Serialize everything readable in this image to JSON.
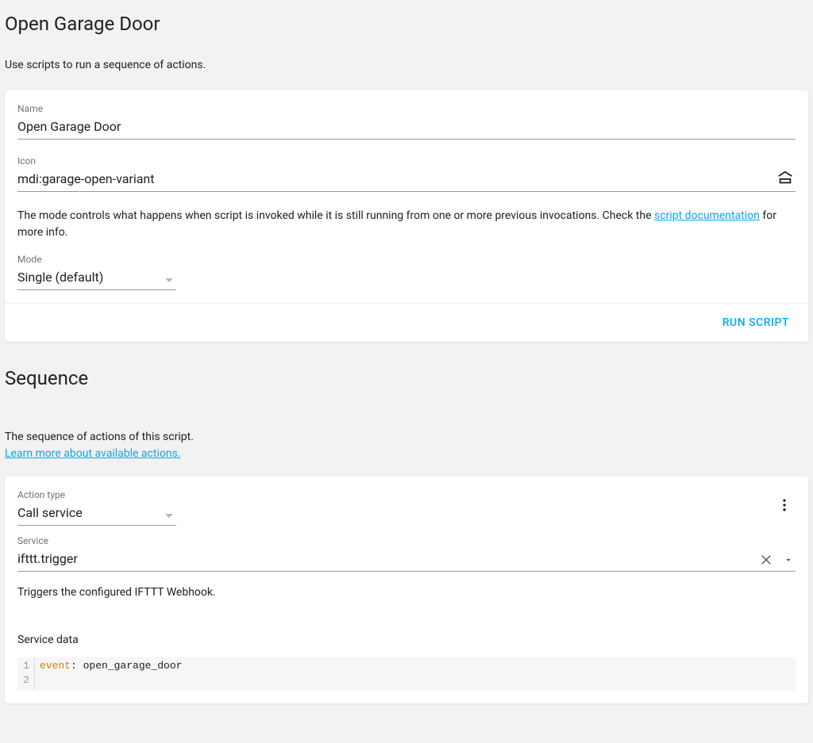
{
  "page": {
    "title": "Open Garage Door",
    "subtitle": "Use scripts to run a sequence of actions."
  },
  "form": {
    "name_label": "Name",
    "name_value": "Open Garage Door",
    "icon_label": "Icon",
    "icon_value": "mdi:garage-open-variant",
    "mode_helper_pre": "The mode controls what happens when script is invoked while it is still running from one or more previous invocations. Check the ",
    "mode_helper_link": "script documentation",
    "mode_helper_post": " for more info.",
    "mode_label": "Mode",
    "mode_value": "Single (default)",
    "run_button": "RUN SCRIPT"
  },
  "sequence": {
    "title": "Sequence",
    "subtitle": "The sequence of actions of this script.",
    "learn_link": "Learn more about available actions."
  },
  "action": {
    "action_type_label": "Action type",
    "action_type_value": "Call service",
    "service_label": "Service",
    "service_value": "ifttt.trigger",
    "service_description": "Triggers the configured IFTTT Webhook.",
    "service_data_label": "Service data",
    "code_line1_key": "event",
    "code_line1_rest": ": open_garage_door",
    "gutter_1": "1",
    "gutter_2": "2"
  }
}
